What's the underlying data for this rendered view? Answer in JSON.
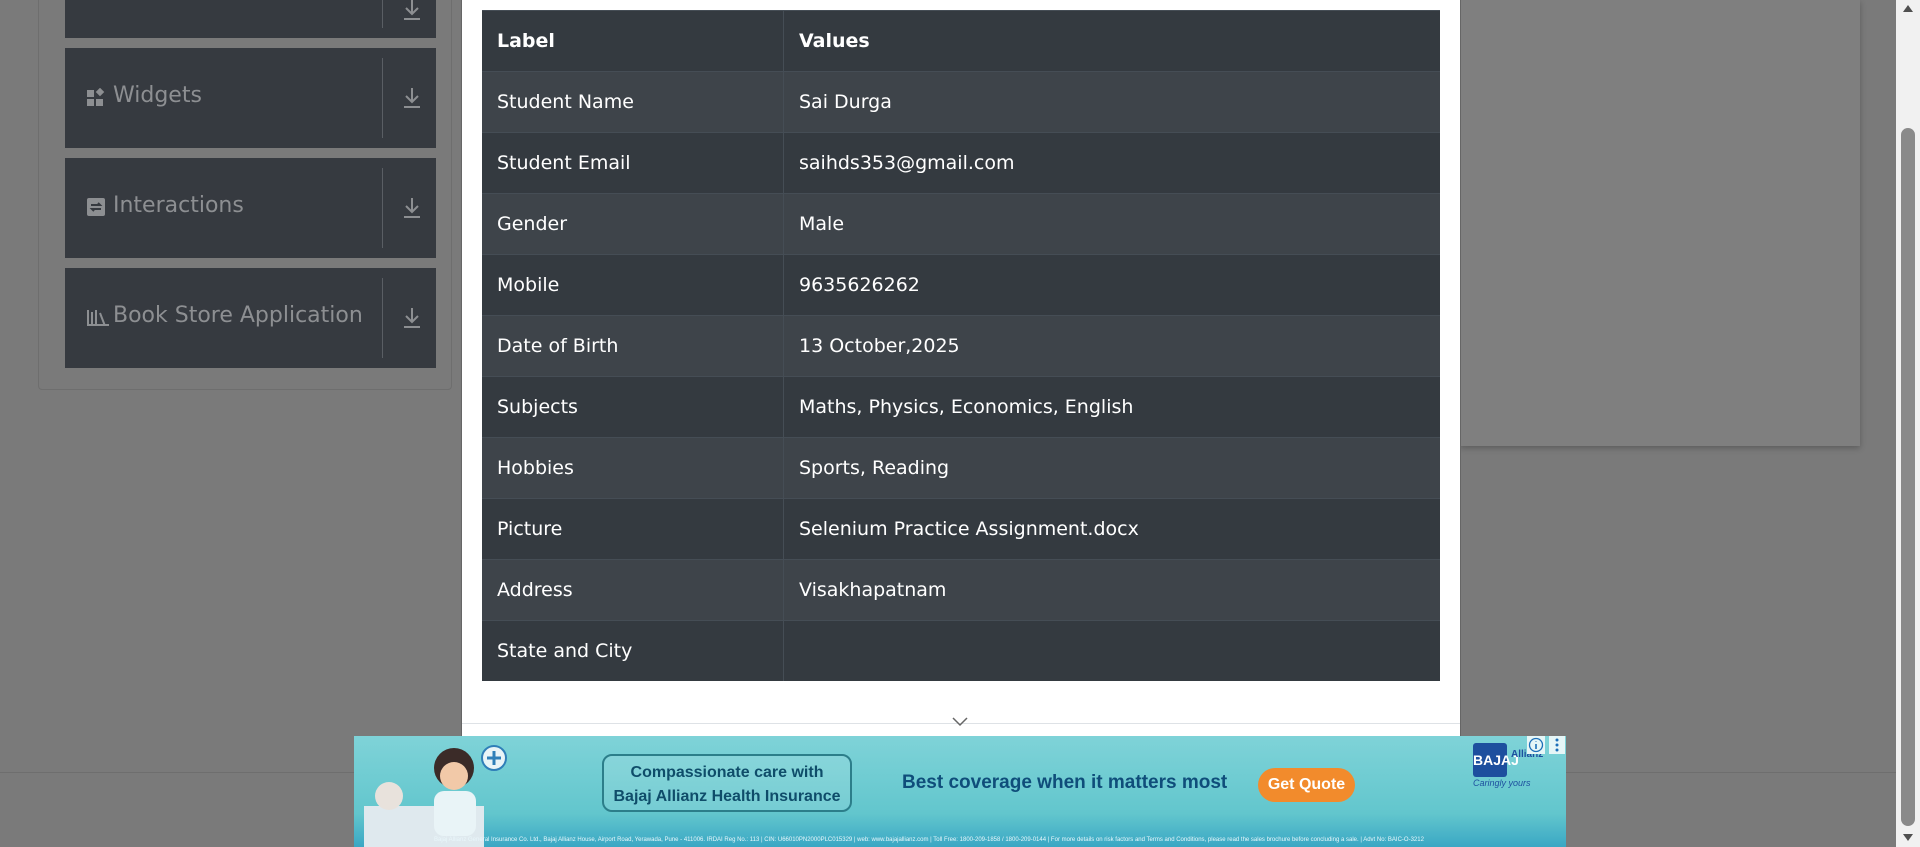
{
  "sidebar": {
    "groups": [
      {
        "label": "Widgets",
        "icon": "widgets-icon"
      },
      {
        "label": "Interactions",
        "icon": "interactions-icon"
      },
      {
        "label": "Book Store Application",
        "icon": "book-store-icon"
      }
    ]
  },
  "modal": {
    "table": {
      "headers": [
        "Label",
        "Values"
      ],
      "rows": [
        {
          "label": "Student Name",
          "value": "Sai Durga"
        },
        {
          "label": "Student Email",
          "value": "saihds353@gmail.com"
        },
        {
          "label": "Gender",
          "value": "Male"
        },
        {
          "label": "Mobile",
          "value": "9635626262"
        },
        {
          "label": "Date of Birth",
          "value": "13 October,2025"
        },
        {
          "label": "Subjects",
          "value": "Maths, Physics, Economics, English"
        },
        {
          "label": "Hobbies",
          "value": "Sports, Reading"
        },
        {
          "label": "Picture",
          "value": "Selenium Practice Assignment.docx"
        },
        {
          "label": "Address",
          "value": "Visakhapatnam"
        },
        {
          "label": "State and City",
          "value": ""
        }
      ]
    }
  },
  "ad": {
    "pill_line1": "Compassionate care with",
    "pill_line2": "Bajaj Allianz Health Insurance",
    "headline": "Best coverage when it matters most",
    "cta": "Get Quote",
    "brand_logo": "BAJAJ",
    "brand_name": "Allianz",
    "tagline": "Caringly yours",
    "disclaimer": "Bajaj Allianz General Insurance Co. Ltd., Bajaj Allianz House, Airport Road, Yerawada, Pune - 411006. IRDAI Reg No.: 113 | CIN: U66010PN2000PLC015329 | web: www.bajajallianz.com | Toll Free: 1800-209-1858 / 1800-209-0144 | For more details on risk factors and Terms and Conditions, please read the sales brochure before concluding a sale. | Advt No: BAIC-O-3212"
  },
  "colors": {
    "table_header": "#343a40",
    "table_row_odd": "#3e444a",
    "overlay": "#7a7a7a",
    "cta": "#f28b2c"
  }
}
